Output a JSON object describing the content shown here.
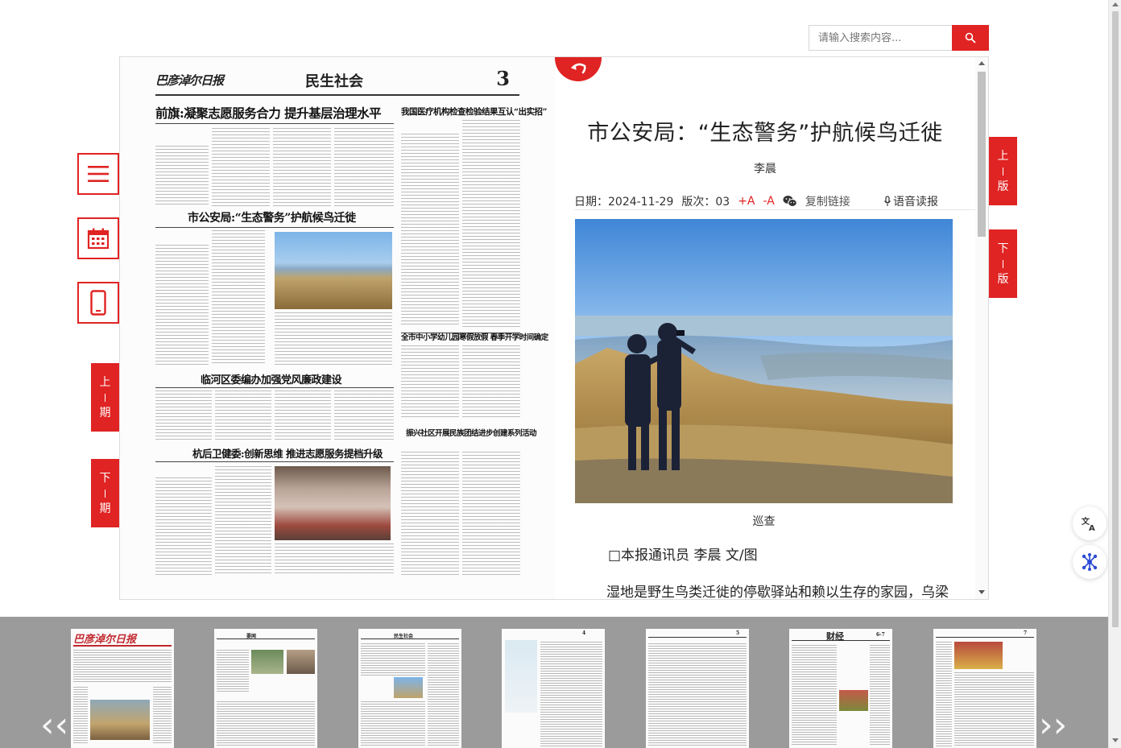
{
  "search": {
    "placeholder": "请输入搜索内容..."
  },
  "newspaper": {
    "logo": "巴彦淖尔日报",
    "section": "民生社会",
    "page_number": "3",
    "headlines": [
      "前旗:凝聚志愿服务合力 提升基层治理水平",
      "我国医疗机构检查检验结果互认“出实招”",
      "市公安局:“生态警务”护航候鸟迁徙",
      "全市中小学幼儿园寒假放假 春季开学时间确定",
      "临河区委编办加强党风廉政建设",
      "杭后卫健委:创新思维 推进志愿服务提档升级",
      "振兴社区开展民族团结进步创建系列活动"
    ]
  },
  "article": {
    "title": "市公安局：“生态警务”护航候鸟迁徙",
    "author": "李晨",
    "date": "日期：2024-11-29",
    "edition": "版次：03",
    "font_increase": "+A",
    "font_decrease": "-A",
    "copy_link": "复制链接",
    "voice_read": "语音读报",
    "photo_caption": "巡查",
    "byline": "□本报通讯员 李晨 文/图",
    "paragraph": "湿地是野生鸟类迁徙的停歇驿站和赖以生存的家园，乌梁"
  },
  "nav": {
    "prev_edition": [
      "上",
      "版"
    ],
    "next_edition": [
      "下",
      "版"
    ],
    "prev_issue": [
      "上",
      "期"
    ],
    "next_issue": [
      "下",
      "期"
    ]
  },
  "thumbnails": [
    {
      "page": "1",
      "label": "巴彦淖尔日报"
    },
    {
      "page": "2",
      "label": "要闻"
    },
    {
      "page": "3",
      "label": "民生社会"
    },
    {
      "page": "4",
      "label": ""
    },
    {
      "page": "5",
      "label": ""
    },
    {
      "page": "6-7",
      "label": "财经"
    },
    {
      "page": "7",
      "label": ""
    }
  ],
  "colors": {
    "accent": "#e02323",
    "strip": "#9b9b9b"
  }
}
